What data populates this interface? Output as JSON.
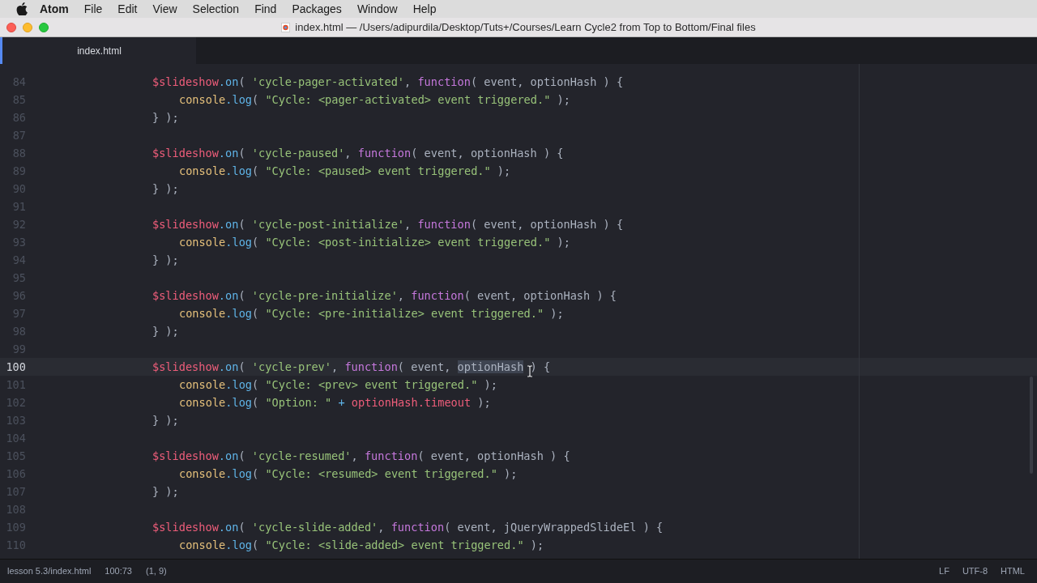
{
  "menu_bar": {
    "app_name": "Atom",
    "items": [
      "File",
      "Edit",
      "View",
      "Selection",
      "Find",
      "Packages",
      "Window",
      "Help"
    ]
  },
  "window": {
    "title": "index.html — /Users/adipurdila/Desktop/Tuts+/Courses/Learn Cycle2 from Top to Bottom/Final files"
  },
  "tabs": [
    {
      "label": "index.html",
      "selected": true
    }
  ],
  "editor": {
    "lines": [
      {
        "number": "84",
        "kind": "outer",
        "current": false,
        "tokens": [
          {
            "kind": "var",
            "text": "$slideshow"
          },
          {
            "kind": "method",
            "text": ".on"
          },
          {
            "kind": "plain",
            "text": "( "
          },
          {
            "kind": "string",
            "text": "'cycle-pager-activated'"
          },
          {
            "kind": "plain",
            "text": ", "
          },
          {
            "kind": "keyword",
            "text": "function"
          },
          {
            "kind": "plain",
            "text": "( event, optionHash ) {"
          }
        ]
      },
      {
        "number": "85",
        "kind": "inner",
        "current": false,
        "tokens": [
          {
            "kind": "object",
            "text": "console"
          },
          {
            "kind": "method",
            "text": ".log"
          },
          {
            "kind": "plain",
            "text": "( "
          },
          {
            "kind": "string",
            "text": "\"Cycle: <pager-activated> event triggered.\""
          },
          {
            "kind": "plain",
            "text": " );"
          }
        ]
      },
      {
        "number": "86",
        "kind": "outer",
        "current": false,
        "tokens": [
          {
            "kind": "plain",
            "text": "} );"
          }
        ]
      },
      {
        "number": "87",
        "kind": "blank",
        "current": false
      },
      {
        "number": "88",
        "kind": "outer",
        "current": false,
        "tokens": [
          {
            "kind": "var",
            "text": "$slideshow"
          },
          {
            "kind": "method",
            "text": ".on"
          },
          {
            "kind": "plain",
            "text": "( "
          },
          {
            "kind": "string",
            "text": "'cycle-paused'"
          },
          {
            "kind": "plain",
            "text": ", "
          },
          {
            "kind": "keyword",
            "text": "function"
          },
          {
            "kind": "plain",
            "text": "( event, optionHash ) {"
          }
        ]
      },
      {
        "number": "89",
        "kind": "inner",
        "current": false,
        "tokens": [
          {
            "kind": "object",
            "text": "console"
          },
          {
            "kind": "method",
            "text": ".log"
          },
          {
            "kind": "plain",
            "text": "( "
          },
          {
            "kind": "string",
            "text": "\"Cycle: <paused> event triggered.\""
          },
          {
            "kind": "plain",
            "text": " );"
          }
        ]
      },
      {
        "number": "90",
        "kind": "outer",
        "current": false,
        "tokens": [
          {
            "kind": "plain",
            "text": "} );"
          }
        ]
      },
      {
        "number": "91",
        "kind": "blank",
        "current": false
      },
      {
        "number": "92",
        "kind": "outer",
        "current": false,
        "tokens": [
          {
            "kind": "var",
            "text": "$slideshow"
          },
          {
            "kind": "method",
            "text": ".on"
          },
          {
            "kind": "plain",
            "text": "( "
          },
          {
            "kind": "string",
            "text": "'cycle-post-initialize'"
          },
          {
            "kind": "plain",
            "text": ", "
          },
          {
            "kind": "keyword",
            "text": "function"
          },
          {
            "kind": "plain",
            "text": "( event, optionHash ) {"
          }
        ]
      },
      {
        "number": "93",
        "kind": "inner",
        "current": false,
        "tokens": [
          {
            "kind": "object",
            "text": "console"
          },
          {
            "kind": "method",
            "text": ".log"
          },
          {
            "kind": "plain",
            "text": "( "
          },
          {
            "kind": "string",
            "text": "\"Cycle: <post-initialize> event triggered.\""
          },
          {
            "kind": "plain",
            "text": " );"
          }
        ]
      },
      {
        "number": "94",
        "kind": "outer",
        "current": false,
        "tokens": [
          {
            "kind": "plain",
            "text": "} );"
          }
        ]
      },
      {
        "number": "95",
        "kind": "blank",
        "current": false
      },
      {
        "number": "96",
        "kind": "outer",
        "current": false,
        "tokens": [
          {
            "kind": "var",
            "text": "$slideshow"
          },
          {
            "kind": "method",
            "text": ".on"
          },
          {
            "kind": "plain",
            "text": "( "
          },
          {
            "kind": "string",
            "text": "'cycle-pre-initialize'"
          },
          {
            "kind": "plain",
            "text": ", "
          },
          {
            "kind": "keyword",
            "text": "function"
          },
          {
            "kind": "plain",
            "text": "( event, optionHash ) {"
          }
        ]
      },
      {
        "number": "97",
        "kind": "inner",
        "current": false,
        "tokens": [
          {
            "kind": "object",
            "text": "console"
          },
          {
            "kind": "method",
            "text": ".log"
          },
          {
            "kind": "plain",
            "text": "( "
          },
          {
            "kind": "string",
            "text": "\"Cycle: <pre-initialize> event triggered.\""
          },
          {
            "kind": "plain",
            "text": " );"
          }
        ]
      },
      {
        "number": "98",
        "kind": "outer",
        "current": false,
        "tokens": [
          {
            "kind": "plain",
            "text": "} );"
          }
        ]
      },
      {
        "number": "99",
        "kind": "blank",
        "current": false
      },
      {
        "number": "100",
        "kind": "outer",
        "current": true,
        "tokens": [
          {
            "kind": "var",
            "text": "$slideshow"
          },
          {
            "kind": "method",
            "text": ".on"
          },
          {
            "kind": "plain",
            "text": "( "
          },
          {
            "kind": "string",
            "text": "'cycle-prev'"
          },
          {
            "kind": "plain",
            "text": ", "
          },
          {
            "kind": "keyword",
            "text": "function"
          },
          {
            "kind": "plain",
            "text": "( event, "
          },
          {
            "kind": "selection",
            "text": "optionHash"
          },
          {
            "kind": "plain",
            "text": " ) {"
          }
        ]
      },
      {
        "number": "101",
        "kind": "inner",
        "current": false,
        "tokens": [
          {
            "kind": "object",
            "text": "console"
          },
          {
            "kind": "method",
            "text": ".log"
          },
          {
            "kind": "plain",
            "text": "( "
          },
          {
            "kind": "string",
            "text": "\"Cycle: <prev> event triggered.\""
          },
          {
            "kind": "plain",
            "text": " );"
          }
        ]
      },
      {
        "number": "102",
        "kind": "inner",
        "current": false,
        "tokens": [
          {
            "kind": "object",
            "text": "console"
          },
          {
            "kind": "method",
            "text": ".log"
          },
          {
            "kind": "plain",
            "text": "( "
          },
          {
            "kind": "string",
            "text": "\"Option: \""
          },
          {
            "kind": "operator",
            "text": " + "
          },
          {
            "kind": "var",
            "text": "optionHash.timeout"
          },
          {
            "kind": "plain",
            "text": " );"
          }
        ]
      },
      {
        "number": "103",
        "kind": "outer",
        "current": false,
        "tokens": [
          {
            "kind": "plain",
            "text": "} );"
          }
        ]
      },
      {
        "number": "104",
        "kind": "blank",
        "current": false
      },
      {
        "number": "105",
        "kind": "outer",
        "current": false,
        "tokens": [
          {
            "kind": "var",
            "text": "$slideshow"
          },
          {
            "kind": "method",
            "text": ".on"
          },
          {
            "kind": "plain",
            "text": "( "
          },
          {
            "kind": "string",
            "text": "'cycle-resumed'"
          },
          {
            "kind": "plain",
            "text": ", "
          },
          {
            "kind": "keyword",
            "text": "function"
          },
          {
            "kind": "plain",
            "text": "( event, optionHash ) {"
          }
        ]
      },
      {
        "number": "106",
        "kind": "inner",
        "current": false,
        "tokens": [
          {
            "kind": "object",
            "text": "console"
          },
          {
            "kind": "method",
            "text": ".log"
          },
          {
            "kind": "plain",
            "text": "( "
          },
          {
            "kind": "string",
            "text": "\"Cycle: <resumed> event triggered.\""
          },
          {
            "kind": "plain",
            "text": " );"
          }
        ]
      },
      {
        "number": "107",
        "kind": "outer",
        "current": false,
        "tokens": [
          {
            "kind": "plain",
            "text": "} );"
          }
        ]
      },
      {
        "number": "108",
        "kind": "blank",
        "current": false
      },
      {
        "number": "109",
        "kind": "outer",
        "current": false,
        "tokens": [
          {
            "kind": "var",
            "text": "$slideshow"
          },
          {
            "kind": "method",
            "text": ".on"
          },
          {
            "kind": "plain",
            "text": "( "
          },
          {
            "kind": "string",
            "text": "'cycle-slide-added'"
          },
          {
            "kind": "plain",
            "text": ", "
          },
          {
            "kind": "keyword",
            "text": "function"
          },
          {
            "kind": "plain",
            "text": "( event, jQueryWrappedSlideEl ) {"
          }
        ]
      },
      {
        "number": "110",
        "kind": "inner",
        "current": false,
        "tokens": [
          {
            "kind": "object",
            "text": "console"
          },
          {
            "kind": "method",
            "text": ".log"
          },
          {
            "kind": "plain",
            "text": "( "
          },
          {
            "kind": "string",
            "text": "\"Cycle: <slide-added> event triggered.\""
          },
          {
            "kind": "plain",
            "text": " );"
          }
        ]
      }
    ]
  },
  "status_bar": {
    "file_path": "lesson 5.3/index.html",
    "cursor_position": "100:73",
    "selection": "(1, 9)",
    "line_ending": "LF",
    "encoding": "UTF-8",
    "grammar": "HTML"
  }
}
